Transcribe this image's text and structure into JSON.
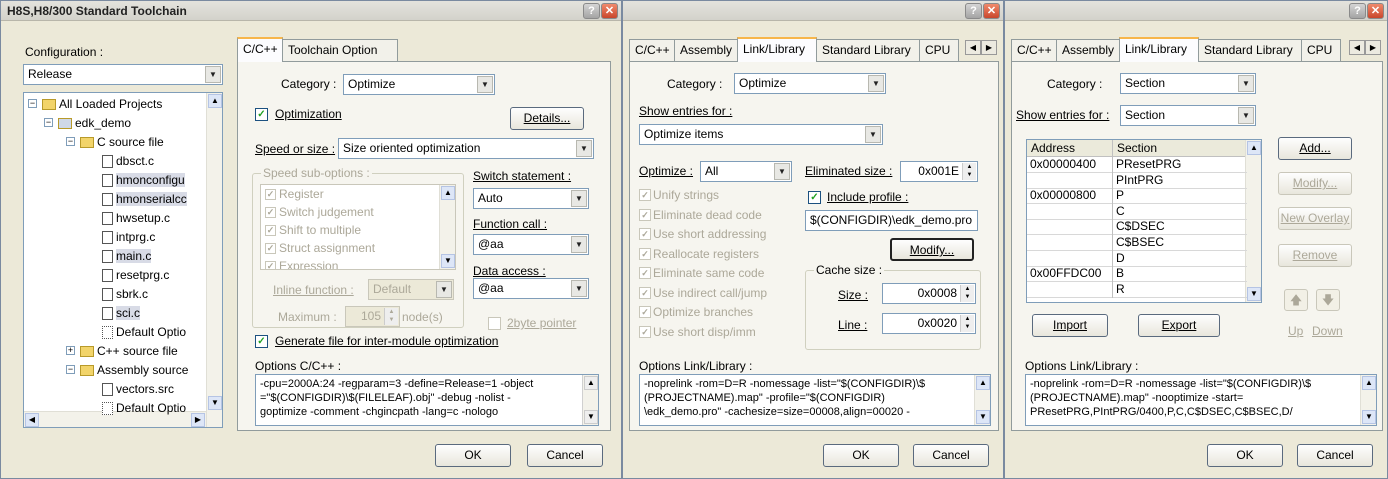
{
  "dialog1": {
    "title": "H8S,H8/300 Standard Toolchain",
    "config_label": "Configuration :",
    "config_value": "Release",
    "tree": [
      {
        "text": "All Loaded Projects",
        "level": 0,
        "icon": "projects-icon",
        "expander": "−"
      },
      {
        "text": "edk_demo",
        "level": 1,
        "icon": "project-icon",
        "expander": "−"
      },
      {
        "text": "C source file",
        "level": 2,
        "icon": "folder-icon",
        "expander": "−"
      },
      {
        "text": "dbsct.c",
        "level": 3,
        "icon": "file-icon"
      },
      {
        "text": "hmonconfigu",
        "level": 3,
        "icon": "file-icon",
        "hl": true
      },
      {
        "text": "hmonserialcc",
        "level": 3,
        "icon": "file-icon",
        "hl": true
      },
      {
        "text": "hwsetup.c",
        "level": 3,
        "icon": "file-icon"
      },
      {
        "text": "intprg.c",
        "level": 3,
        "icon": "file-icon"
      },
      {
        "text": "main.c",
        "level": 3,
        "icon": "file-icon",
        "hl": true
      },
      {
        "text": "resetprg.c",
        "level": 3,
        "icon": "file-icon"
      },
      {
        "text": "sbrk.c",
        "level": 3,
        "icon": "file-icon"
      },
      {
        "text": "sci.c",
        "level": 3,
        "icon": "file-icon",
        "hl": true
      },
      {
        "text": "Default Optio",
        "level": 3,
        "icon": "default-file-icon"
      },
      {
        "text": "C++ source file",
        "level": 2,
        "icon": "folder-icon",
        "expander": "+"
      },
      {
        "text": "Assembly source",
        "level": 2,
        "icon": "folder-icon",
        "expander": "−"
      },
      {
        "text": "vectors.src",
        "level": 3,
        "icon": "file-icon"
      },
      {
        "text": "Default Optio",
        "level": 3,
        "icon": "default-file-icon"
      }
    ],
    "tabs": [
      "C/C++",
      "Toolchain Option"
    ],
    "category_label": "Category :",
    "category_value": "Optimize",
    "optimization_label": "Optimization",
    "details_button": "Details...",
    "speed_label": "Speed or size :",
    "speed_value": "Size oriented optimization",
    "sub_options_label": "Speed sub-options :",
    "sub_options": [
      "Register",
      "Switch judgement",
      "Shift to multiple",
      "Struct assignment",
      "Expression"
    ],
    "switch_label": "Switch statement :",
    "switch_value": "Auto",
    "function_call_label": "Function call :",
    "function_call_value": "@aa",
    "data_access_label": "Data access :",
    "data_access_value": "@aa",
    "inline_label": "Inline function :",
    "inline_value": "Default",
    "maximum_label": "Maximum :",
    "maximum_value": "105",
    "node_label": "node(s)",
    "twobyte_label": "2byte pointer",
    "generate_label": "Generate file for inter-module optimization",
    "options_label": "Options C/C++ :",
    "options_lines": [
      "-cpu=2000A:24 -regparam=3 -define=Release=1 -object",
      "=\"$(CONFIGDIR)\\$(FILELEAF).obj\" -debug -nolist -",
      "goptimize -comment -chgincpath -lang=c -nologo"
    ],
    "ok": "OK",
    "cancel": "Cancel"
  },
  "dialog2": {
    "tabs": [
      "C/C++",
      "Assembly",
      "Link/Library",
      "Standard Library",
      "CPU"
    ],
    "category_label": "Category :",
    "category_value": "Optimize",
    "show_entries_label": "Show entries for :",
    "show_entries_value": "Optimize items",
    "optimize_label": "Optimize :",
    "optimize_value": "All",
    "items": [
      "Unify strings",
      "Eliminate dead code",
      "Use short addressing",
      "Reallocate registers",
      "Eliminate same code",
      "Use indirect call/jump",
      "Optimize branches",
      "Use short disp/imm"
    ],
    "eliminated_label": "Eliminated size :",
    "eliminated_value": "0x001E",
    "include_profile_label": "Include profile :",
    "profile_path": "$(CONFIGDIR)\\edk_demo.pro",
    "modify_button": "Modify...",
    "cache_label": "Cache size :",
    "size_label": "Size :",
    "size_value": "0x0008",
    "line_label": "Line :",
    "line_value": "0x0020",
    "options_label": "Options Link/Library :",
    "options_lines": [
      "-noprelink -rom=D=R -nomessage -list=\"$(CONFIGDIR)\\$",
      "(PROJECTNAME).map\" -profile=\"$(CONFIGDIR)",
      "\\edk_demo.pro\" -cachesize=size=00008,align=00020 -"
    ],
    "ok": "OK",
    "cancel": "Cancel"
  },
  "dialog3": {
    "tabs": [
      "C/C++",
      "Assembly",
      "Link/Library",
      "Standard Library",
      "CPU"
    ],
    "category_label": "Category :",
    "category_value": "Section",
    "show_entries_label": "Show entries for :",
    "show_entries_value": "Section",
    "col_address": "Address",
    "col_section": "Section",
    "rows": [
      {
        "address": "0x00000400",
        "section": "PResetPRG"
      },
      {
        "address": "",
        "section": "PIntPRG"
      },
      {
        "address": "0x00000800",
        "section": "P"
      },
      {
        "address": "",
        "section": "C"
      },
      {
        "address": "",
        "section": "C$DSEC"
      },
      {
        "address": "",
        "section": "C$BSEC"
      },
      {
        "address": "",
        "section": "D"
      },
      {
        "address": "0x00FFDC00",
        "section": "B"
      },
      {
        "address": "",
        "section": "R"
      }
    ],
    "add_button": "Add...",
    "modify_button": "Modify...",
    "new_overlay_button": "New Overlay",
    "remove_button": "Remove",
    "import_button": "Import",
    "export_button": "Export",
    "up_label": "Up",
    "down_label": "Down",
    "options_label": "Options Link/Library :",
    "options_lines": [
      "-noprelink -rom=D=R -nomessage -list=\"$(CONFIGDIR)\\$",
      "(PROJECTNAME).map\" -nooptimize -start=",
      "PResetPRG,PIntPRG/0400,P,C,C$DSEC,C$BSEC,D/"
    ],
    "ok": "OK",
    "cancel": "Cancel"
  },
  "ui": {
    "help_glyph": "?",
    "close_glyph": "✕",
    "check_glyph": "✓",
    "arrow_left": "◀",
    "arrow_right": "▶",
    "arrow_down": "▼",
    "arrow_up": "▲",
    "up_arrow_big": "🡅",
    "down_arrow_big": "🡇"
  }
}
